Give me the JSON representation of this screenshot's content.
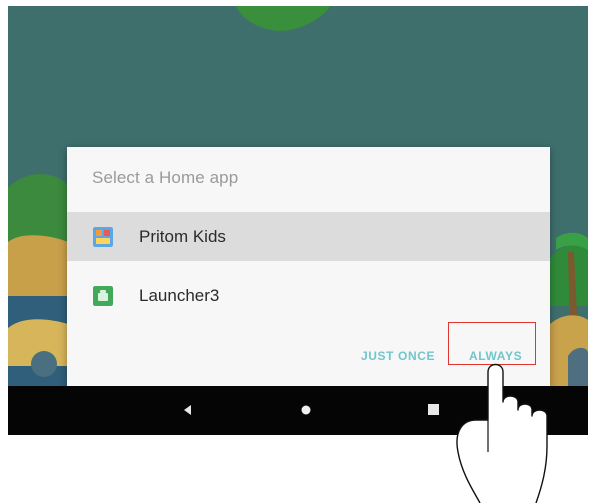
{
  "dialog": {
    "title": "Select a Home app",
    "apps": [
      {
        "label": "Pritom Kids",
        "icon": "pritom-kids-app-icon",
        "selected": true
      },
      {
        "label": "Launcher3",
        "icon": "launcher3-app-icon",
        "selected": false
      }
    ],
    "actions": {
      "just_once": "JUST ONCE",
      "always": "ALWAYS"
    }
  },
  "navbar": {
    "back_icon": "back-triangle-icon",
    "home_icon": "home-circle-icon",
    "recents_icon": "recents-square-icon"
  },
  "annotation": {
    "highlight_color": "#e0362f",
    "pointer_icon": "pointing-hand-icon"
  },
  "colors": {
    "wallpaper": "#3f6f6d",
    "accent": "#6fc6cc",
    "selected_row": "#dcdcdc",
    "dialog": "#f7f7f7",
    "navbar": "#050505"
  }
}
